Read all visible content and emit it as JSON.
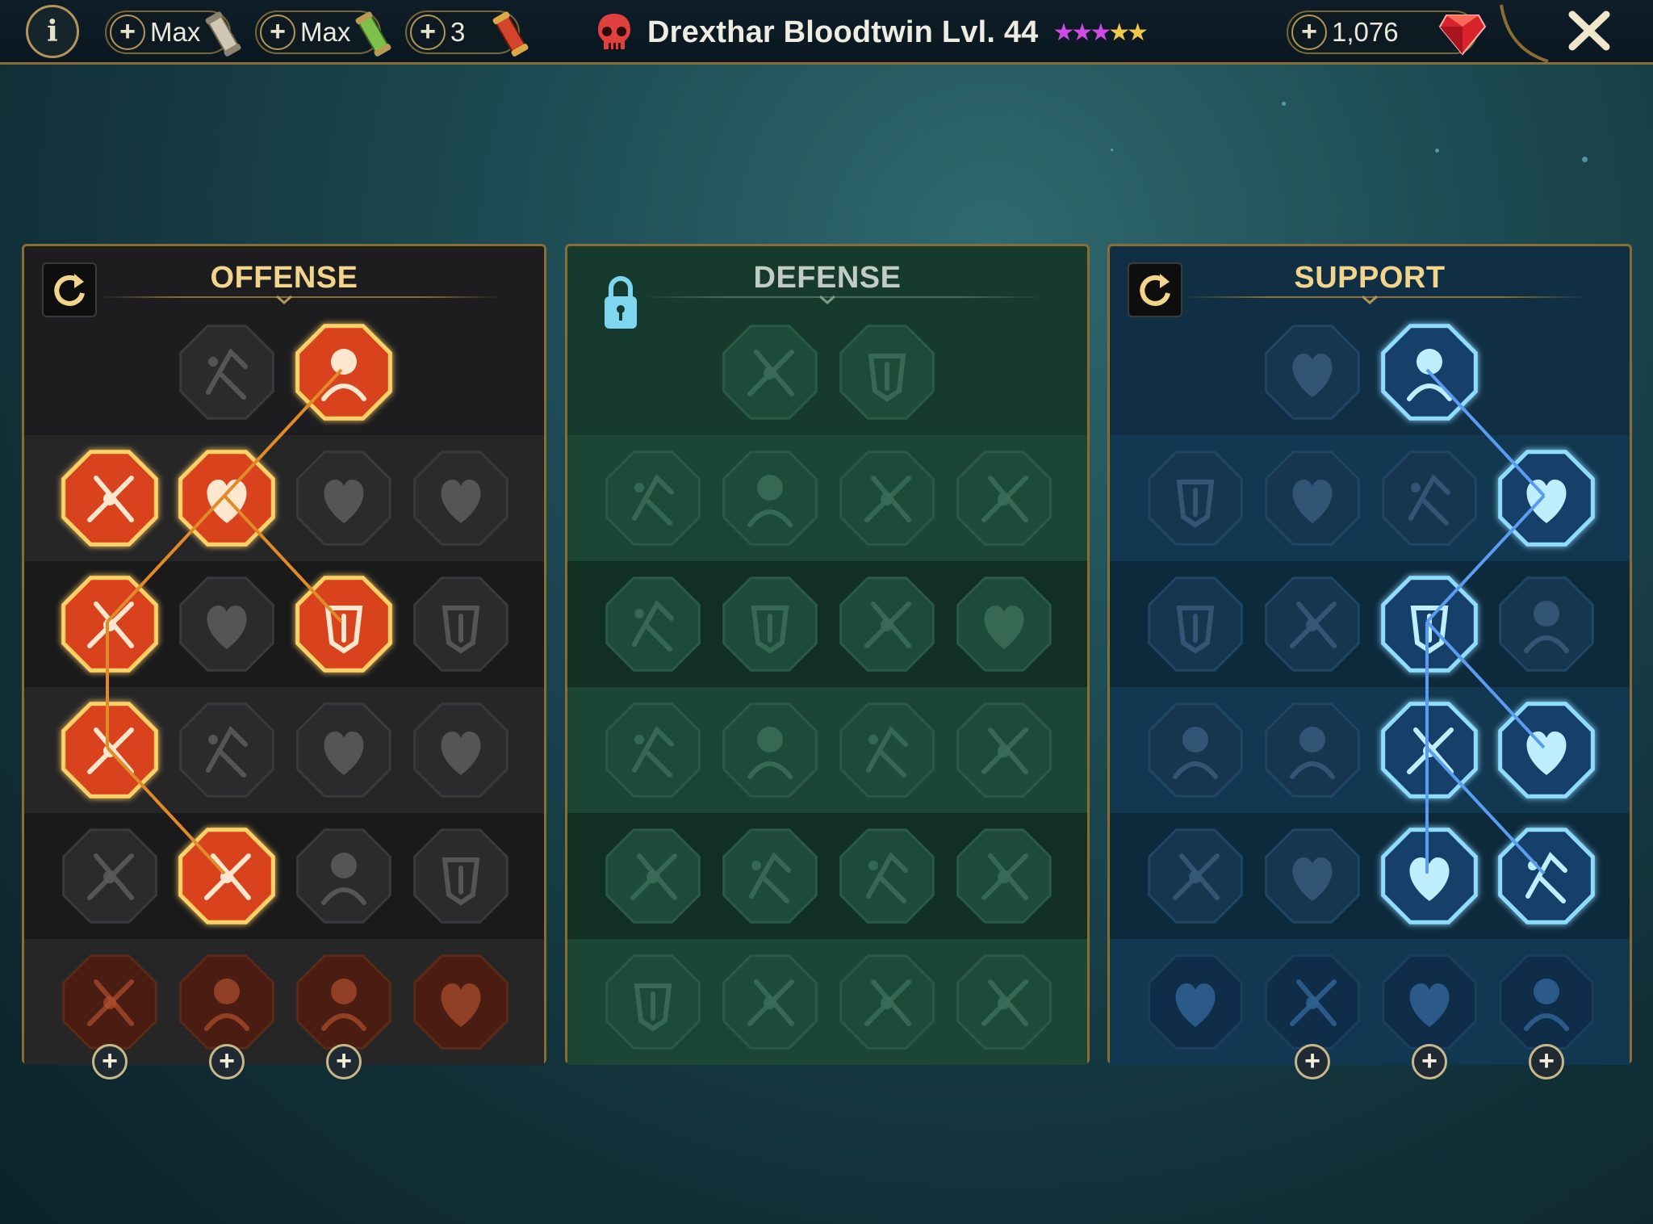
{
  "header": {
    "info_label": "i",
    "resources": [
      {
        "label": "Max",
        "icon": "silver-scroll-icon"
      },
      {
        "label": "Max",
        "icon": "green-scroll-icon"
      },
      {
        "label": "3",
        "icon": "red-scroll-icon"
      }
    ],
    "champion_name": "Drexthar Bloodtwin Lvl. 44",
    "star_rating": 5,
    "star_colors": [
      "#d04be6",
      "#d04be6",
      "#d04be6",
      "#f1c84a",
      "#f1c84a"
    ],
    "gems": "1,076",
    "close_label": "✕"
  },
  "colors": {
    "offense_accent": "#f08a2a",
    "support_accent": "#53b8ff",
    "gold_border": "#8a6d33"
  },
  "trees": [
    {
      "name": "OFFENSE",
      "state": "active",
      "nodes": [
        [
          "",
          "crossed-swords",
          "blade-strike"
        ],
        [
          "demon-heart",
          "trident-slash",
          "shield-pierce",
          "broken-heart"
        ],
        [
          "arrow-barrage",
          "fang-bite",
          "skull-slash",
          "dagger-grip"
        ],
        [
          "bleeding-heart",
          "fist-strike",
          "axe",
          "chained-lightning"
        ],
        [
          "helm-spikes",
          "triple-skull",
          "spear-aura",
          "strongman"
        ],
        [
          "sparkle-sword",
          "flaming-helm",
          "horned-demon",
          "spiked-skull"
        ]
      ],
      "selected": [
        [
          0,
          2
        ],
        [
          1,
          0
        ],
        [
          1,
          1
        ],
        [
          2,
          0
        ],
        [
          2,
          2
        ],
        [
          3,
          0
        ],
        [
          4,
          1
        ]
      ],
      "links": [
        [
          [
            0,
            2
          ],
          [
            1,
            1
          ]
        ],
        [
          [
            1,
            1
          ],
          [
            2,
            0
          ]
        ],
        [
          [
            1,
            1
          ],
          [
            2,
            2
          ]
        ],
        [
          [
            2,
            0
          ],
          [
            3,
            0
          ]
        ],
        [
          [
            3,
            0
          ],
          [
            4,
            1
          ]
        ]
      ],
      "capstone_buttons": [
        0,
        1,
        2
      ]
    },
    {
      "name": "DEFENSE",
      "state": "locked",
      "nodes": [
        [
          "",
          "stone-blocks",
          "raised-fist"
        ],
        [
          "shield-crest",
          "anatomic-heart",
          "armored-giant",
          "crossed-blade"
        ],
        [
          "archer",
          "knight-shield",
          "skull-heart",
          "hooded-figure"
        ],
        [
          "spectre",
          "skull-hourglass",
          "open-hand",
          "bull-head"
        ],
        [
          "dashing-figure",
          "blood-drops",
          "crowned-skull",
          "swirl-hand"
        ],
        [
          "fiery-warrior",
          "winged-shield",
          "bearded-skull",
          "muscle-man"
        ]
      ],
      "selected": [],
      "links": [],
      "capstone_buttons": []
    },
    {
      "name": "SUPPORT",
      "state": "active",
      "nodes": [
        [
          "",
          "heart-plus",
          "speed-burst"
        ],
        [
          "praying-hands",
          "shield-dome",
          "smoking-skull",
          "hand-wind"
        ],
        [
          "healing-figure",
          "lightning-shield",
          "lightning-crack",
          "shadow-figure"
        ],
        [
          "chained-heart",
          "comet",
          "open-book",
          "angry-eyes"
        ],
        [
          "compass-star",
          "swift-boot",
          "all-seeing-eye",
          "mystic-dancer"
        ],
        [
          "potion-flask",
          "horned-skull",
          "raised-fist-flame",
          "eagle-head"
        ]
      ],
      "selected": [
        [
          0,
          2
        ],
        [
          1,
          3
        ],
        [
          2,
          2
        ],
        [
          3,
          2
        ],
        [
          3,
          3
        ],
        [
          4,
          2
        ],
        [
          4,
          3
        ]
      ],
      "links": [
        [
          [
            0,
            2
          ],
          [
            1,
            3
          ]
        ],
        [
          [
            1,
            3
          ],
          [
            2,
            2
          ]
        ],
        [
          [
            2,
            2
          ],
          [
            3,
            2
          ]
        ],
        [
          [
            2,
            2
          ],
          [
            3,
            3
          ]
        ],
        [
          [
            3,
            2
          ],
          [
            4,
            2
          ]
        ],
        [
          [
            3,
            2
          ],
          [
            4,
            3
          ]
        ]
      ],
      "capstone_buttons": [
        1,
        2,
        3
      ]
    }
  ]
}
